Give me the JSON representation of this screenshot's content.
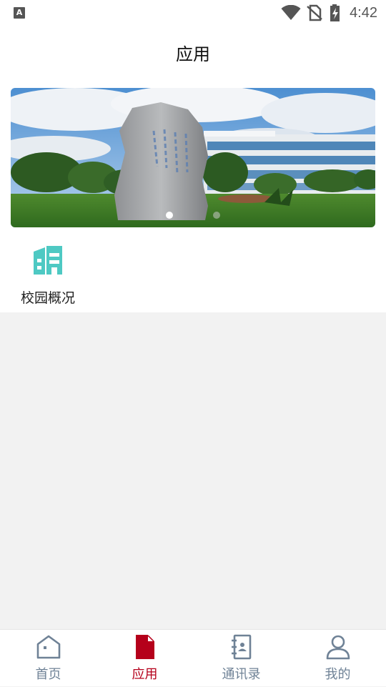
{
  "status_bar": {
    "app_icon": "A",
    "time": "4:42",
    "icons": [
      "wifi-icon",
      "no-sim-icon",
      "battery-charging-icon"
    ]
  },
  "header": {
    "title": "应用"
  },
  "banner": {
    "slide_count": 2,
    "active_index": 0
  },
  "apps": [
    {
      "label": "校园概况",
      "icon": "building-icon",
      "color": "#4ec9c3"
    }
  ],
  "tabbar": {
    "active_color": "#b5001b",
    "inactive_color": "#6f8296",
    "tabs": [
      {
        "label": "首页",
        "icon": "home-icon",
        "active": false
      },
      {
        "label": "应用",
        "icon": "document-icon",
        "active": true
      },
      {
        "label": "通讯录",
        "icon": "contacts-icon",
        "active": false
      },
      {
        "label": "我的",
        "icon": "person-icon",
        "active": false
      }
    ]
  }
}
